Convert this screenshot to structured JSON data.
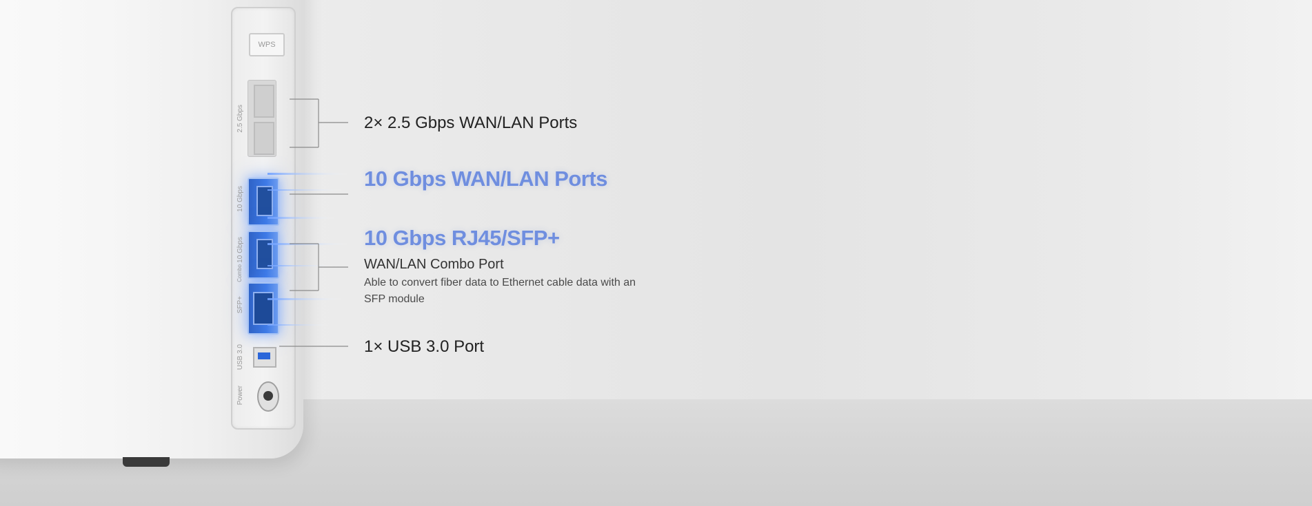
{
  "device": {
    "wps_label": "WPS",
    "port_labels": {
      "group1": "2.5 Gbps",
      "group2": "10 Gbps",
      "group3": "10 Gbps",
      "combo": "Combo",
      "sfp": "SFP+",
      "usb": "USB 3.0",
      "power": "Power"
    }
  },
  "callouts": {
    "wan_lan_25": "2× 2.5 Gbps WAN/LAN Ports",
    "wan_lan_10": "10 Gbps WAN/LAN Ports",
    "rj45_sfp": "10 Gbps RJ45/SFP+",
    "combo_title": "WAN/LAN Combo Port",
    "combo_desc": "Able to convert fiber data to Ethernet cable data with an SFP module",
    "usb": "1× USB 3.0 Port"
  },
  "colors": {
    "highlight": "#6f8edf",
    "port_blue": "#3e7ae6",
    "text": "#222222"
  }
}
